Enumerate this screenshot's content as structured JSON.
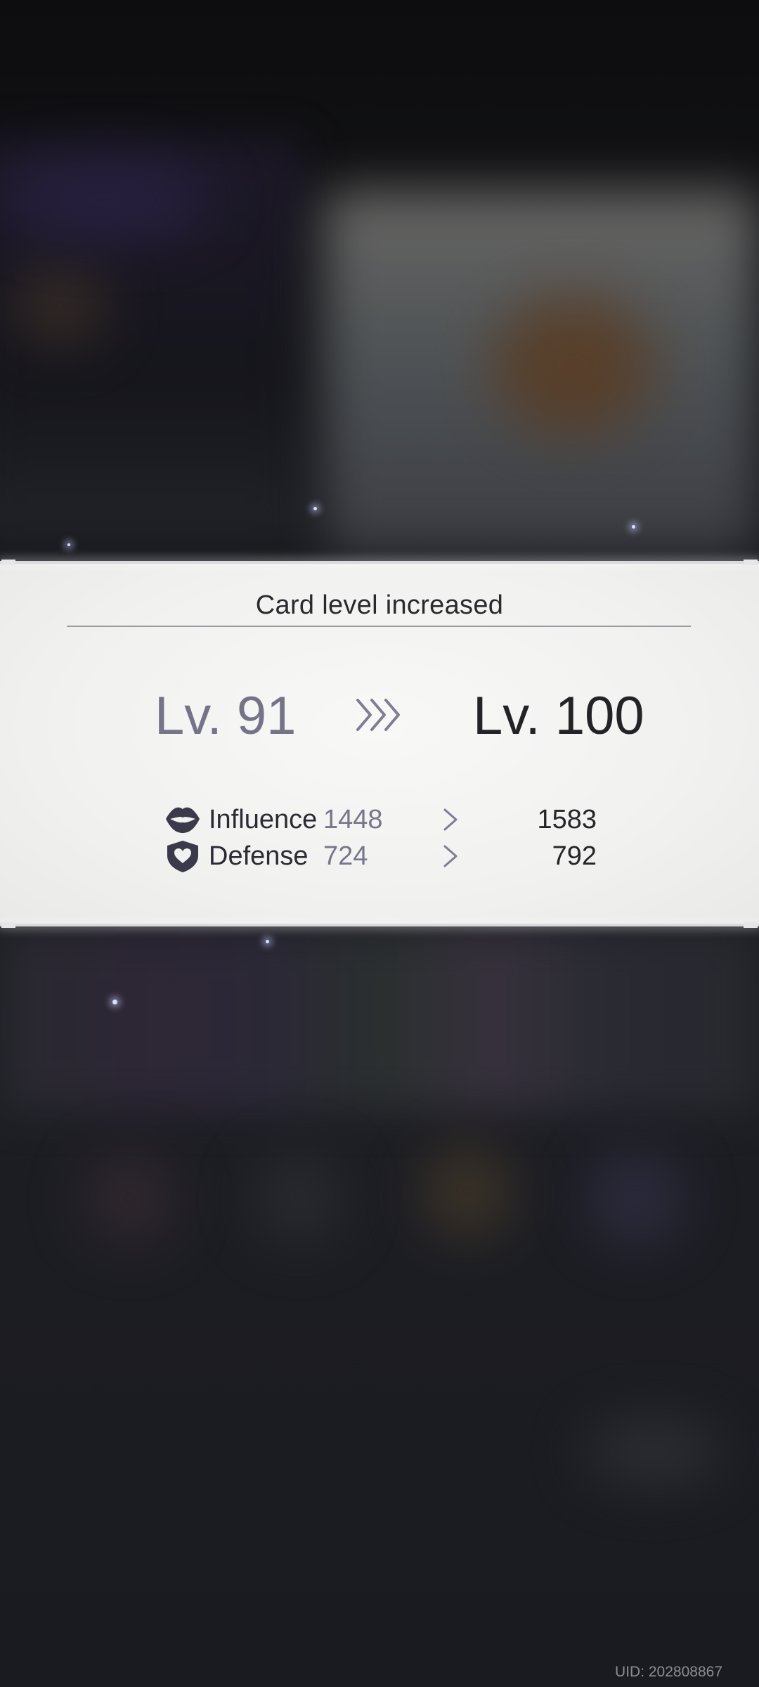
{
  "dialog": {
    "title": "Card level increased",
    "old_level": "Lv. 91",
    "new_level": "Lv. 100",
    "level_arrow_icon": "triple-chevron-right-icon"
  },
  "stats": [
    {
      "icon": "lips-icon",
      "label": "Influence",
      "old_value": "1448",
      "new_value": "1583"
    },
    {
      "icon": "heart-shield-icon",
      "label": "Defense",
      "old_value": "724",
      "new_value": "792"
    }
  ],
  "footer": {
    "uid": "UID: 202808867"
  },
  "colors": {
    "panel_background": "#f1f1f0",
    "old_value_text": "#747388",
    "new_value_text": "#232327",
    "icon_fill": "#3b3a4b",
    "screen_background": "#121317"
  }
}
